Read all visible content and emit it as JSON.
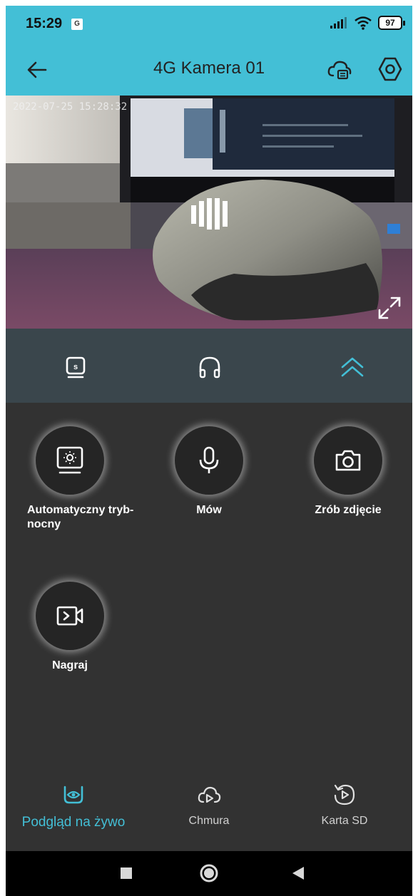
{
  "status_bar": {
    "time": "15:29",
    "notification": "G",
    "battery": "97"
  },
  "app_bar": {
    "title": "4G Kamera 01",
    "back_icon": "arrow-left-icon",
    "cloud_icon": "cloud-storage-icon",
    "settings_icon": "hexagon-settings-icon"
  },
  "video": {
    "timestamp": "2022-07-25 15:28:32",
    "loading_icon": "loading-bars-icon",
    "fullscreen_icon": "expand-icon"
  },
  "controls": {
    "icons": [
      "sd-quality-icon",
      "headphones-icon",
      "chevron-up-double-icon"
    ],
    "accent": "#43bfd6"
  },
  "actions": [
    {
      "label": "Automatyczny tryb-nocny",
      "icon": "night-mode-monitor-icon"
    },
    {
      "label": "Mów",
      "icon": "microphone-icon"
    },
    {
      "label": "Zrób zdjęcie",
      "icon": "camera-icon"
    },
    {
      "label": "Nagraj",
      "icon": "record-video-icon"
    }
  ],
  "bottom_nav": [
    {
      "label": "Podgląd na żywo",
      "icon": "live-eye-icon",
      "active": true
    },
    {
      "label": "Chmura",
      "icon": "cloud-play-icon",
      "active": false
    },
    {
      "label": "Karta SD",
      "icon": "sd-replay-icon",
      "active": false
    }
  ],
  "colors": {
    "accent": "#43bfd6",
    "panel": "#323232",
    "control_bar": "#3a464c"
  }
}
